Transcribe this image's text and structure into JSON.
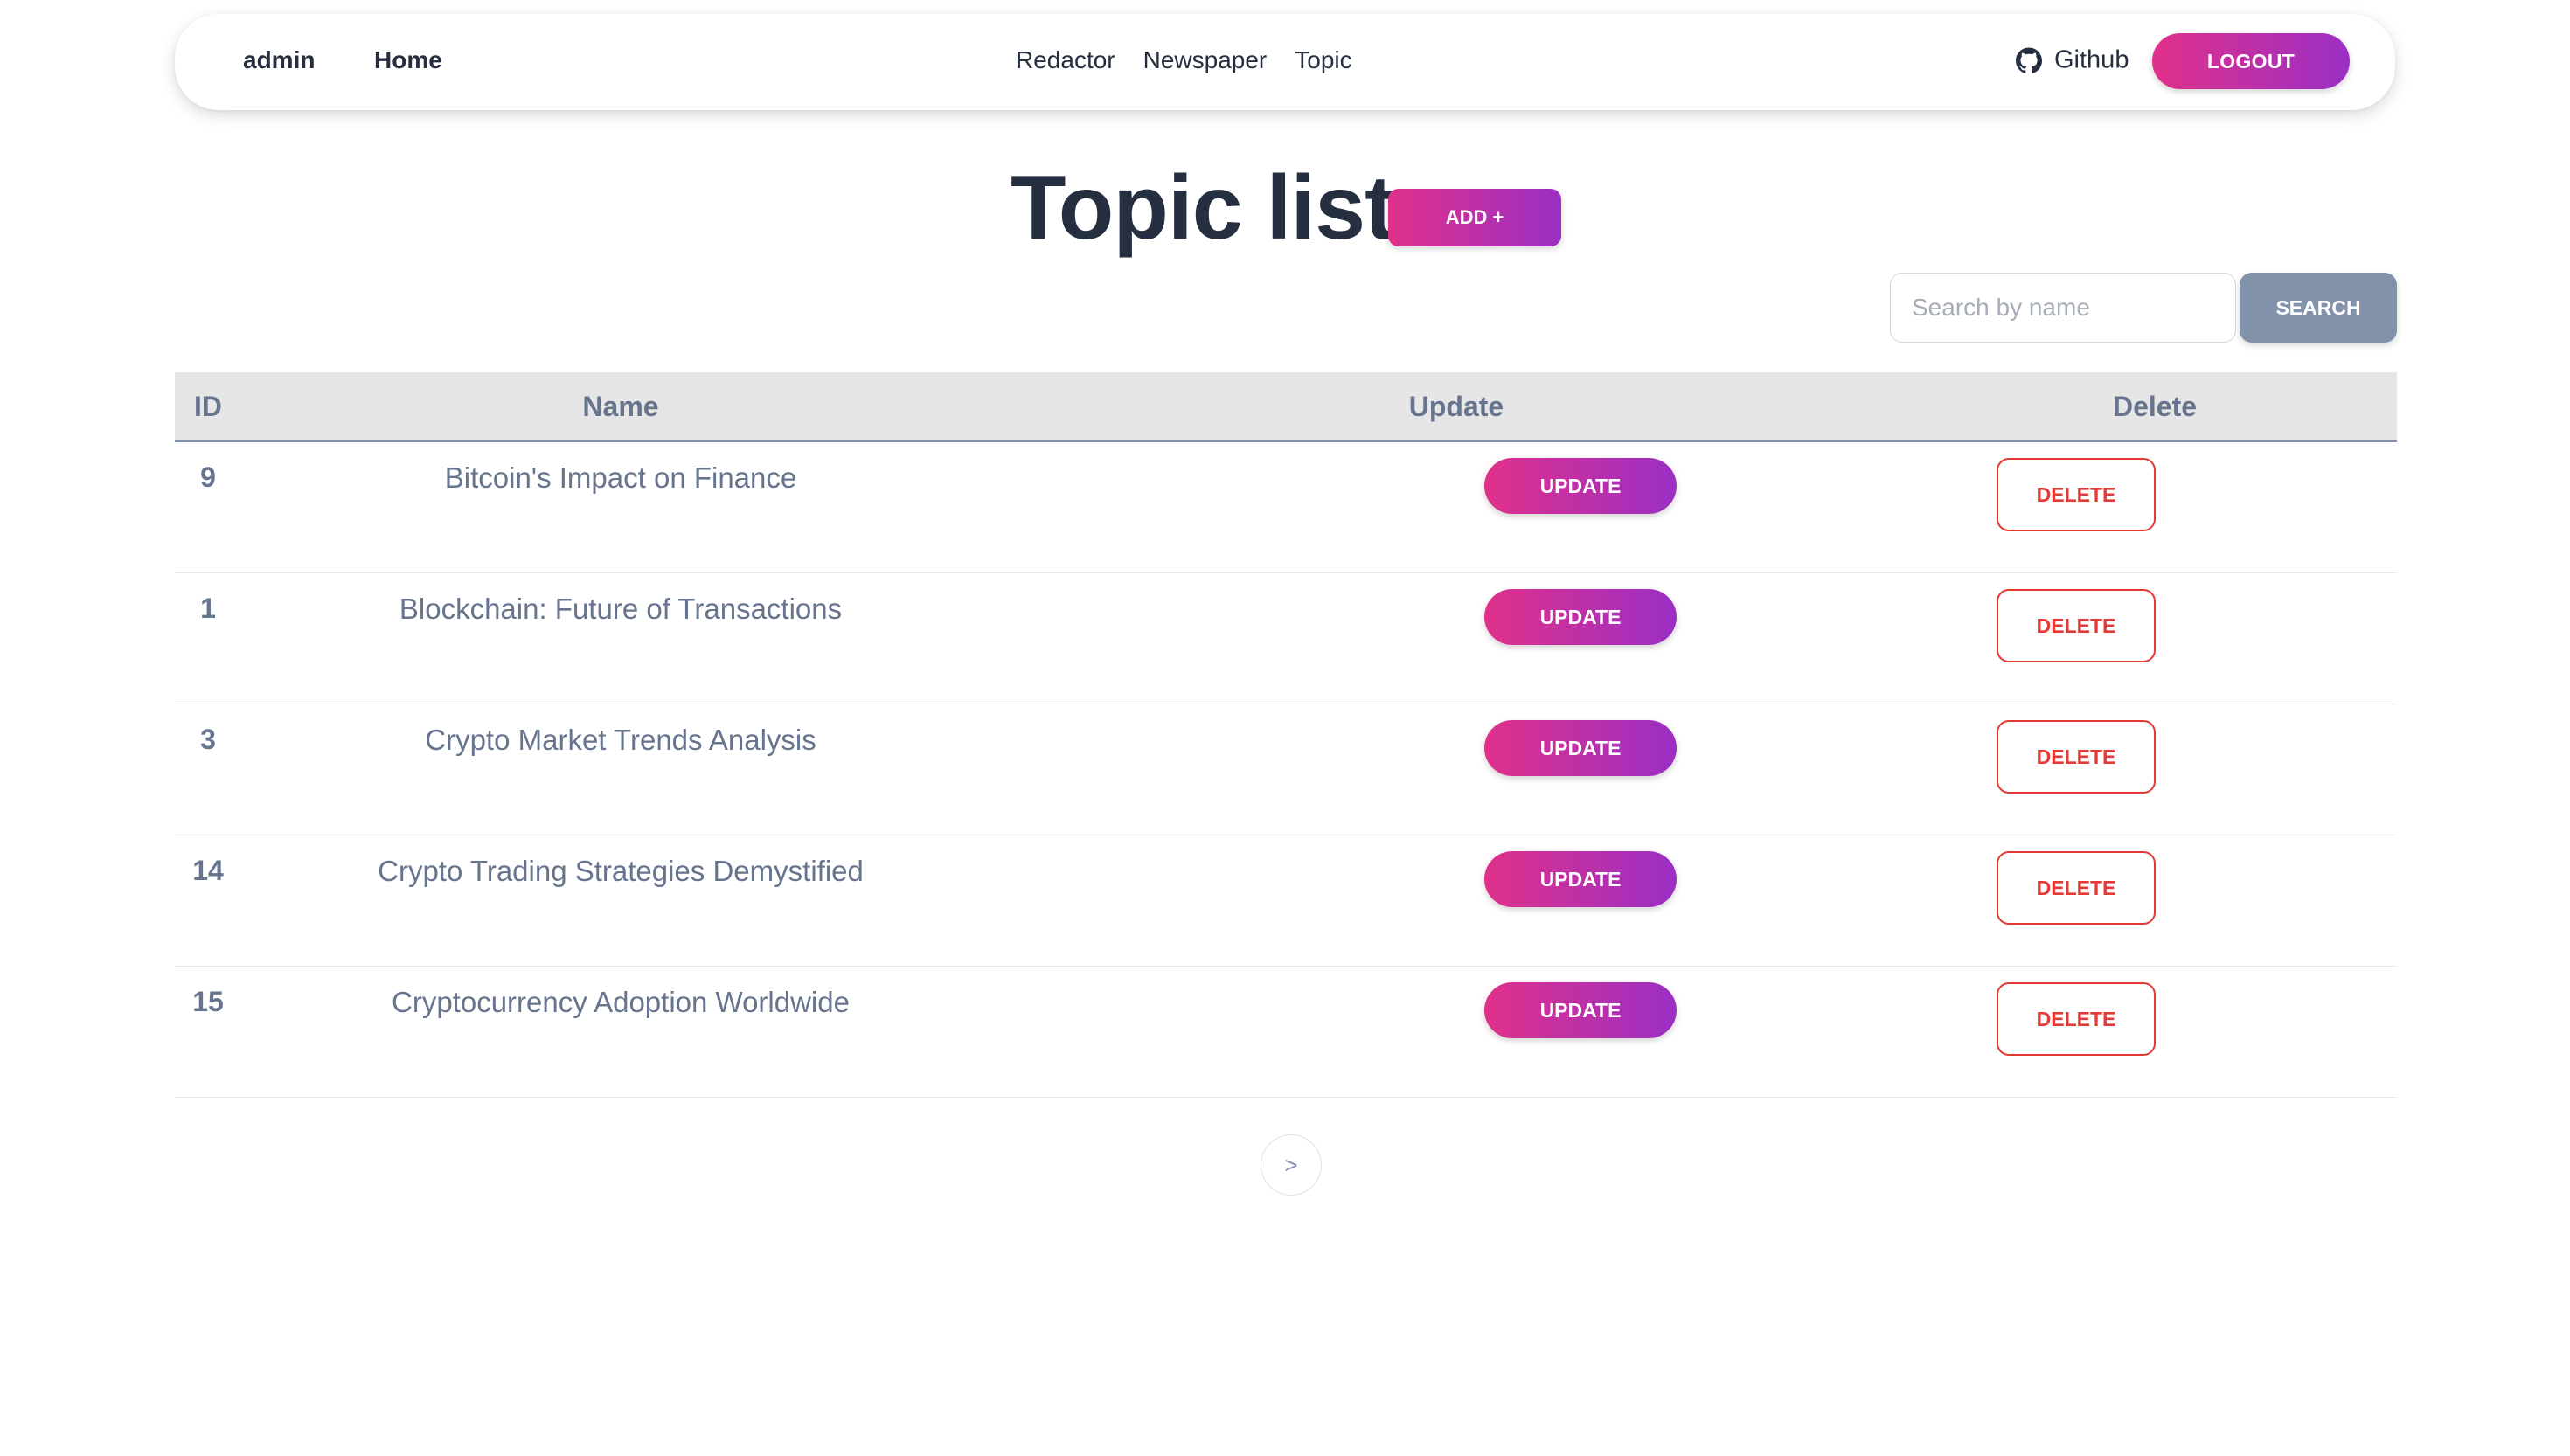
{
  "navbar": {
    "user": "admin",
    "home": "Home",
    "links": [
      "Redactor",
      "Newspaper",
      "Topic"
    ],
    "github": "Github",
    "github_icon": "github-icon",
    "logout": "LOGOUT"
  },
  "title": "Topic list",
  "add_label": "ADD +",
  "search": {
    "placeholder": "Search by name",
    "button": "SEARCH"
  },
  "table": {
    "headers": {
      "id": "ID",
      "name": "Name",
      "update": "Update",
      "delete": "Delete"
    },
    "rows": [
      {
        "id": "9",
        "name": "Bitcoin's Impact on Finance"
      },
      {
        "id": "1",
        "name": "Blockchain: Future of Transactions"
      },
      {
        "id": "3",
        "name": "Crypto Market Trends Analysis"
      },
      {
        "id": "14",
        "name": "Crypto Trading Strategies Demystified"
      },
      {
        "id": "15",
        "name": "Cryptocurrency Adoption Worldwide"
      }
    ],
    "update_label": "UPDATE",
    "delete_label": "DELETE"
  },
  "pagination": {
    "next": ">"
  },
  "colors": {
    "accent_start": "#e0308a",
    "accent_end": "#9a2fc4",
    "danger": "#e53935",
    "search_button": "#8392ab"
  }
}
